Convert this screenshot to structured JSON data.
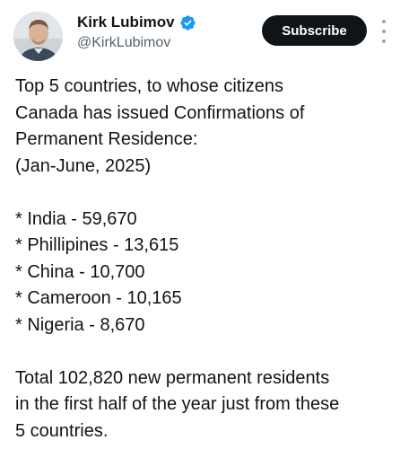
{
  "author": {
    "display_name": "Kirk Lubimov",
    "handle": "@KirkLubimov",
    "verified_icon": "verified-badge-icon",
    "verified_color": "#1d9bf0"
  },
  "actions": {
    "subscribe_label": "Subscribe",
    "more_icon": "more-vertical-icon"
  },
  "post": {
    "intro_lines": [
      "Top 5 countries, to whose citizens",
      "Canada has issued Confirmations of",
      "Permanent Residence:",
      "(Jan-June, 2025)"
    ],
    "list_items": [
      "* India - 59,670",
      "* Phillipines - 13,615",
      "* China - 10,700",
      "* Cameroon - 10,165",
      "* Nigeria - 8,670"
    ],
    "summary_lines": [
      "Total 102,820 new permanent residents",
      "in the first half of the year just from these",
      "5 countries."
    ]
  },
  "colors": {
    "text": "#0f1419",
    "secondary_text": "#536471",
    "button_bg": "#0f1419",
    "button_text": "#ffffff"
  }
}
